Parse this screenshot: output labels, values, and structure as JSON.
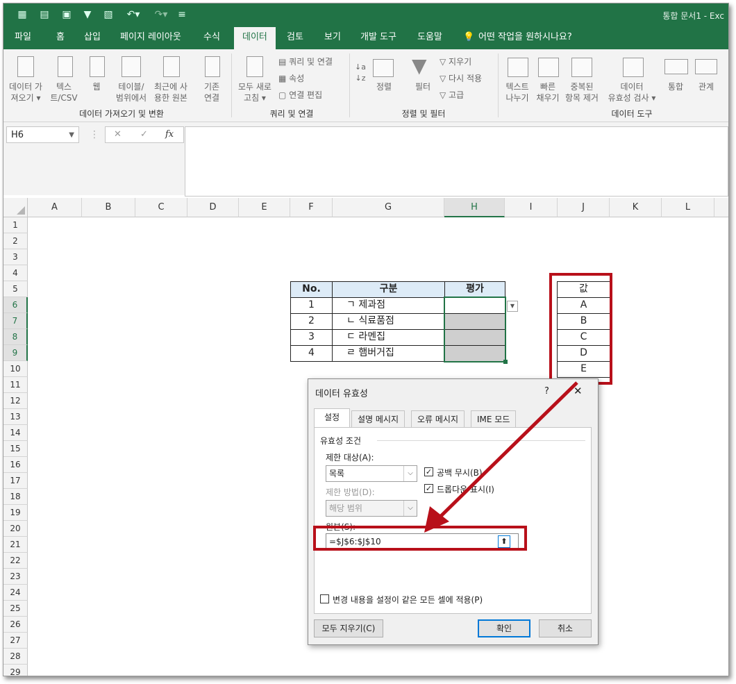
{
  "app": {
    "title": "통합 문서1 - Exc"
  },
  "tabs": [
    "파일",
    "홈",
    "삽입",
    "페이지 레이아웃",
    "수식",
    "데이터",
    "검토",
    "보기",
    "개발 도구",
    "도움말"
  ],
  "active_tab": "데이터",
  "tell_me": "어떤 작업을 원하시나요?",
  "ribbon": {
    "get_data": {
      "btn1": [
        "데이터 가",
        "져오기 ▾"
      ],
      "btn2": [
        "텍스",
        "트/CSV"
      ],
      "btn3": [
        "웹",
        ""
      ],
      "btn4": [
        "테이블/",
        "범위에서"
      ],
      "btn5": [
        "최근에 사",
        "용한 원본"
      ],
      "btn6": [
        "기존",
        "연결"
      ],
      "label": "데이터 가져오기 및 변환"
    },
    "query": {
      "refresh": [
        "모두 새로",
        "고침 ▾"
      ],
      "q1": "쿼리 및 연결",
      "q2": "속성",
      "q3": "연결 편집",
      "label": "쿼리 및 연결"
    },
    "sort": {
      "sort_btn": "정렬",
      "filter_btn": "필터",
      "clear": "지우기",
      "reapply": "다시 적용",
      "advanced": "고급",
      "label": "정렬 및 필터"
    },
    "tools": {
      "text_cols": [
        "텍스트",
        "나누기"
      ],
      "flash": [
        "빠른",
        "채우기"
      ],
      "dup": [
        "중복된",
        "항목 제거"
      ],
      "valid": [
        "데이터",
        "유효성 검사 ▾"
      ],
      "consol": "통합",
      "rel": "관계",
      "label": "데이터 도구"
    }
  },
  "formula_bar": {
    "name_box": "H6",
    "cancel": "✕",
    "enter": "✓",
    "fx": "fx"
  },
  "columns": [
    "A",
    "B",
    "C",
    "D",
    "E",
    "F",
    "G",
    "H",
    "I",
    "J",
    "K",
    "L"
  ],
  "rows": [
    "1",
    "2",
    "3",
    "4",
    "5",
    "6",
    "7",
    "8",
    "9",
    "10",
    "11",
    "12",
    "13",
    "14",
    "15",
    "16",
    "17",
    "18",
    "19",
    "20",
    "21",
    "22",
    "23",
    "24",
    "25",
    "26",
    "27",
    "28",
    "29"
  ],
  "table": {
    "headers": [
      "No.",
      "구분",
      "평가"
    ],
    "rows": [
      [
        "1",
        "ㄱ 제과점",
        ""
      ],
      [
        "2",
        "ㄴ 식료품점",
        ""
      ],
      [
        "3",
        "ㄷ 라멘집",
        ""
      ],
      [
        "4",
        "ㄹ 햄버거집",
        ""
      ]
    ]
  },
  "value_list": {
    "header": "값",
    "items": [
      "A",
      "B",
      "C",
      "D",
      "E"
    ]
  },
  "dialog": {
    "title": "데이터 유효성",
    "help": "?",
    "close": "✕",
    "tabs": [
      "설정",
      "설명 메시지",
      "오류 메시지",
      "IME 모드"
    ],
    "section": "유효성 조건",
    "allow_label": "제한 대상(A):",
    "allow_value": "목록",
    "ignore_blank": "공백 무시(B)",
    "dropdown": "드롭다운 표시(I)",
    "data_label": "제한 방법(D):",
    "data_value": "해당 범위",
    "source_label": "원본(S):",
    "source_value": "=$J$6:$J$10",
    "apply_all": "변경 내용을 설정이 같은 모든 셀에 적용(P)",
    "clear_all": "모두 지우기(C)",
    "ok": "확인",
    "cancel": "취소"
  },
  "colors": {
    "excel_green": "#217346",
    "highlight_red": "#b8101a",
    "header_blue": "#ddebf7"
  }
}
